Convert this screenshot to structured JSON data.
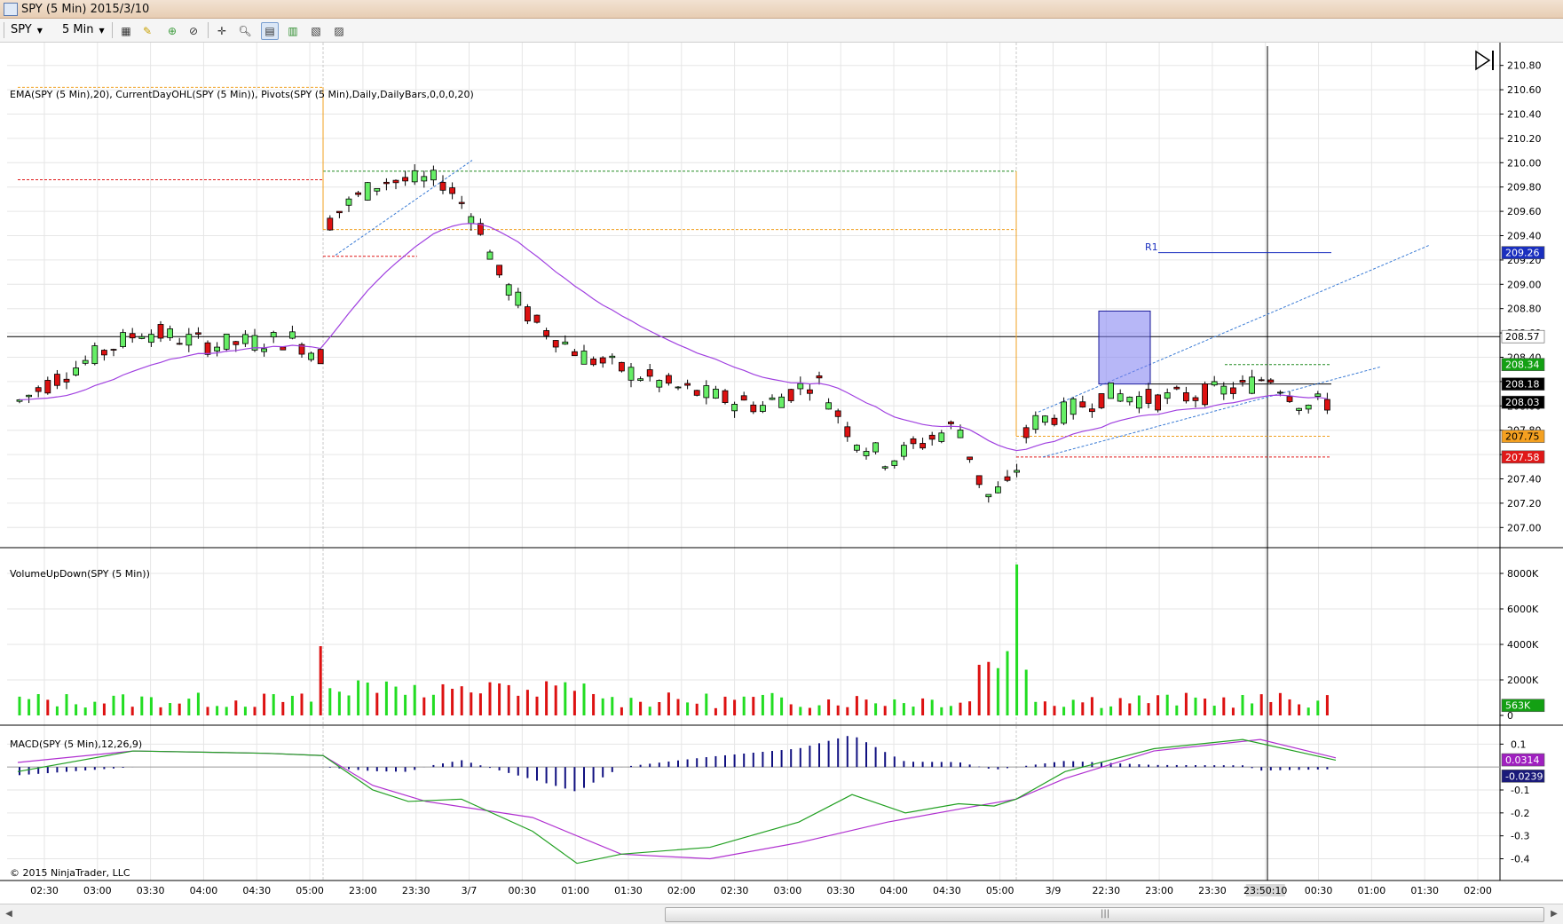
{
  "window": {
    "title": "SPY (5 Min)  2015/3/10"
  },
  "toolbar": {
    "instrument": "SPY",
    "interval": "5 Min"
  },
  "price_panel": {
    "indicator_label": "EMA(SPY (5 Min),20), CurrentDayOHL(SPY (5 Min)), Pivots(SPY (5 Min),Daily,DailyBars,0,0,0,20)",
    "y_ticks": [
      "210.80",
      "210.60",
      "210.40",
      "210.20",
      "210.00",
      "209.80",
      "209.60",
      "209.40",
      "209.20",
      "209.00",
      "208.80",
      "208.60",
      "208.40",
      "208.20",
      "208.00",
      "207.80",
      "207.60",
      "207.40",
      "207.20",
      "207.00"
    ],
    "pivot_label": "R1",
    "markers": [
      {
        "text": "209.26",
        "color": "#1a2fbf",
        "text_color": "#ffffff",
        "price": 209.26
      },
      {
        "text": "208.57",
        "color": "#ffffff",
        "text_color": "#000000",
        "price": 208.57
      },
      {
        "text": "208.34",
        "color": "#13a013",
        "text_color": "#ffffff",
        "price": 208.34
      },
      {
        "text": "208.18",
        "color": "#000000",
        "text_color": "#ffffff",
        "price": 208.18
      },
      {
        "text": "208.03",
        "color": "#000000",
        "text_color": "#ffffff",
        "price": 208.03
      },
      {
        "text": "207.75",
        "color": "#f4a020",
        "text_color": "#000000",
        "price": 207.75
      },
      {
        "text": "207.58",
        "color": "#e01818",
        "text_color": "#ffffff",
        "price": 207.58
      }
    ]
  },
  "volume_panel": {
    "label": "VolumeUpDown(SPY (5 Min))",
    "y_ticks": [
      "8000K",
      "6000K",
      "4000K",
      "2000K",
      "0"
    ],
    "marker": {
      "text": "563K",
      "color": "#13a013",
      "text_color": "#ffffff"
    }
  },
  "macd_panel": {
    "label": "MACD(SPY (5 Min),12,26,9)",
    "y_ticks": [
      "0.1",
      "-0.1",
      "-0.2",
      "-0.3",
      "-0.4"
    ],
    "markers": [
      {
        "text": "0.0314",
        "color": "#a020c0",
        "text_color": "#ffffff"
      },
      {
        "text": "-0.0239",
        "color": "#1a1a7a",
        "text_color": "#ffffff"
      }
    ]
  },
  "copyright": "© 2015 NinjaTrader, LLC",
  "x_axis": {
    "labels": [
      "02:30",
      "03:00",
      "03:30",
      "04:00",
      "04:30",
      "05:00",
      "23:00",
      "23:30",
      "3/7",
      "00:30",
      "01:00",
      "01:30",
      "02:00",
      "02:30",
      "03:00",
      "03:30",
      "04:00",
      "04:30",
      "05:00",
      "3/9",
      "22:30",
      "23:00",
      "23:30",
      "23:50:10",
      "00:30",
      "01:00",
      "01:30",
      "02:00"
    ],
    "highlight": "23:50:10"
  },
  "colors": {
    "up": "#66ee66",
    "down": "#dd1111",
    "ema": "#a040e0",
    "macd_avg": "#b030d0",
    "macd_line": "#22a022",
    "macd_hist": "#101080"
  },
  "chart_data": {
    "type": "candlestick",
    "symbol": "SPY",
    "interval": "5 Min",
    "ohlc_sample": [
      {
        "o": 207.98,
        "h": 208.05,
        "l": 207.9,
        "c": 208.02
      },
      {
        "o": 208.02,
        "h": 208.15,
        "l": 207.85,
        "c": 208.1
      },
      {
        "o": 208.1,
        "h": 208.3,
        "l": 208.05,
        "c": 208.25
      },
      {
        "o": 208.25,
        "h": 208.5,
        "l": 208.2,
        "c": 208.45
      },
      {
        "o": 208.45,
        "h": 208.6,
        "l": 208.4,
        "c": 208.55
      },
      {
        "o": 208.55,
        "h": 208.58,
        "l": 208.3,
        "c": 208.4
      },
      {
        "o": 208.4,
        "h": 208.6,
        "l": 208.1,
        "c": 208.55
      },
      {
        "o": 208.55,
        "h": 208.7,
        "l": 208.4,
        "c": 208.62
      },
      {
        "o": 208.7,
        "h": 208.72,
        "l": 208.4,
        "c": 208.5
      },
      {
        "o": 208.5,
        "h": 208.65,
        "l": 208.35,
        "c": 208.6
      },
      {
        "o": 208.6,
        "h": 208.6,
        "l": 208.2,
        "c": 208.3
      },
      {
        "o": 208.3,
        "h": 208.4,
        "l": 208.0,
        "c": 208.1
      },
      {
        "o": 208.1,
        "h": 208.3,
        "l": 207.95,
        "c": 208.25
      },
      {
        "o": 208.25,
        "h": 208.35,
        "l": 208.1,
        "c": 208.15
      },
      {
        "o": 208.15,
        "h": 208.4,
        "l": 208.1,
        "c": 208.35
      },
      {
        "o": 208.35,
        "h": 208.4,
        "l": 208.2,
        "c": 208.28
      },
      {
        "o": 208.28,
        "h": 208.34,
        "l": 208.0,
        "c": 208.05
      },
      {
        "o": 208.05,
        "h": 208.15,
        "l": 207.9,
        "c": 208.1
      },
      {
        "o": 208.1,
        "h": 208.25,
        "l": 208.0,
        "c": 208.18
      },
      {
        "o": 208.18,
        "h": 208.3,
        "l": 208.1,
        "c": 208.03
      }
    ],
    "volume_sample_k": [
      350,
      600,
      450,
      500,
      380,
      1200,
      900,
      700,
      8500,
      3800,
      1700,
      1500,
      1400,
      1300,
      1200,
      900,
      700,
      600,
      600,
      563
    ],
    "macd_sample": [
      0.02,
      0.03,
      0.05,
      0.06,
      0.04,
      -0.05,
      -0.15,
      -0.18,
      -0.25,
      -0.35,
      -0.4,
      -0.38,
      -0.3,
      -0.22,
      -0.15,
      -0.18,
      -0.1,
      -0.05,
      0.05,
      0.0314
    ]
  }
}
